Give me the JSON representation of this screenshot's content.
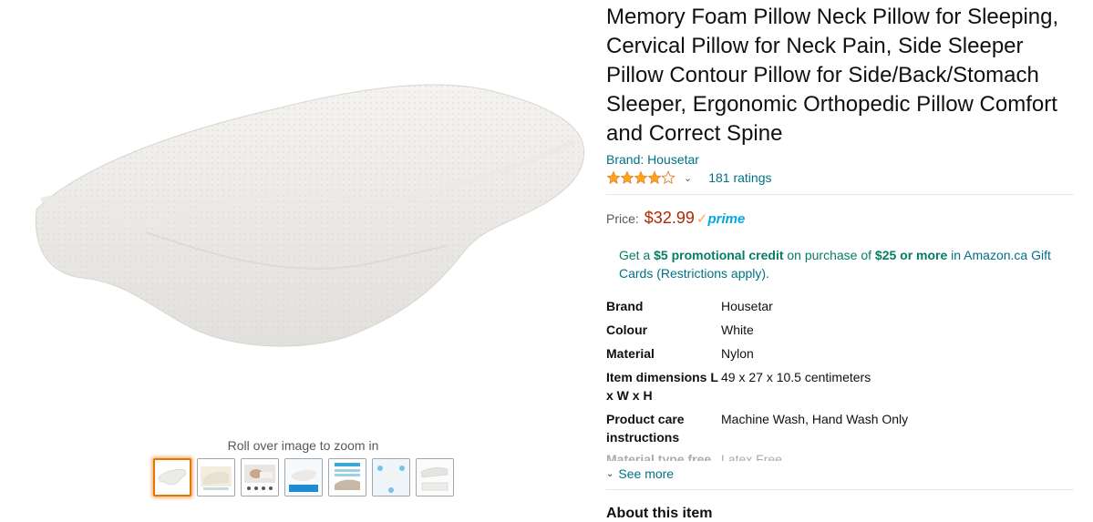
{
  "gallery": {
    "zoom_hint": "Roll over image to zoom in",
    "thumbnail_count": 7,
    "selected_index": 0
  },
  "product": {
    "title": "Memory Foam Pillow Neck Pillow for Sleeping, Cervical Pillow for Neck Pain, Side Sleeper Pillow Contour Pillow for Side/Back/Stomach Sleeper, Ergonomic Orthopedic Pillow Comfort and Correct Spine",
    "brand_link": "Brand: Housetar",
    "rating_stars": 4.5,
    "ratings_count": "181 ratings",
    "price_label": "Price:",
    "price": "$32.99",
    "prime_check": "✓",
    "prime_word": "prime"
  },
  "promo": {
    "p1": "Get a ",
    "credit": "$5 promotional credit",
    "p2": " on purchase of ",
    "amount": "$25 or more",
    "p3": " in Amazon.ca Gift Cards (Restrictions apply)."
  },
  "specs": [
    {
      "key": "Brand",
      "value": "Housetar"
    },
    {
      "key": "Colour",
      "value": "White"
    },
    {
      "key": "Material",
      "value": "Nylon"
    },
    {
      "key": "Item dimensions L x W x H",
      "value": "49 x 27 x 10.5 centimeters"
    },
    {
      "key": "Product care instructions",
      "value": "Machine Wash, Hand Wash Only"
    },
    {
      "key": "Material type free",
      "value": "Latex Free"
    }
  ],
  "see_more": "See more",
  "about_heading": "About this item",
  "colors": {
    "link": "#007185",
    "price": "#B12704",
    "star": "#FFA41C",
    "prime_blue": "#00a8e1",
    "selected_thumb": "#e77600"
  }
}
